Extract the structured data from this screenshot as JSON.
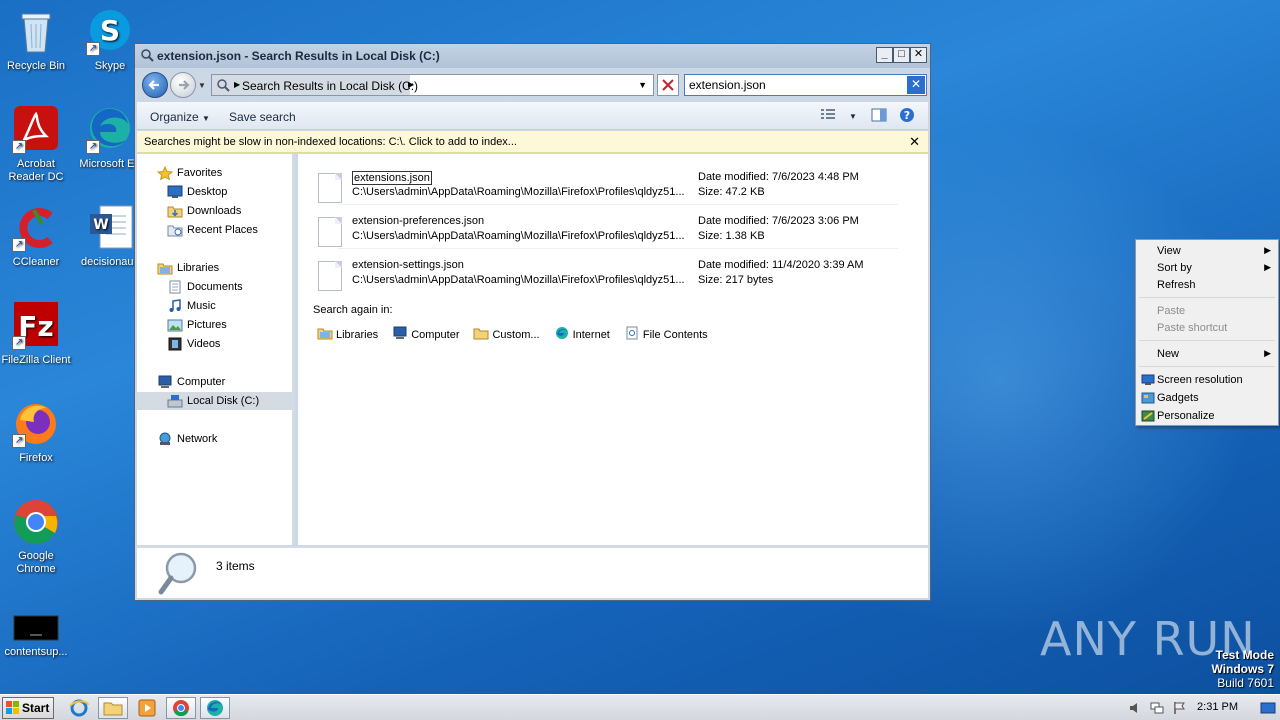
{
  "desktop": {
    "icons": [
      {
        "label": "Recycle Bin",
        "icon": "recycle-bin-icon"
      },
      {
        "label": "Skype",
        "icon": "skype-icon"
      },
      {
        "label": "Acrobat Reader DC",
        "icon": "acrobat-icon"
      },
      {
        "label": "Microsoft Ed",
        "icon": "edge-icon"
      },
      {
        "label": "CCleaner",
        "icon": "ccleaner-icon"
      },
      {
        "label": "decisionaus",
        "icon": "word-doc-icon"
      },
      {
        "label": "FileZilla Client",
        "icon": "filezilla-icon"
      },
      {
        "label": "Firefox",
        "icon": "firefox-icon"
      },
      {
        "label": "Google Chrome",
        "icon": "chrome-icon"
      },
      {
        "label": "contentsup...",
        "icon": "black-file-icon"
      }
    ],
    "watermark": "ANY RUN",
    "test_mode": {
      "line1": "Test Mode",
      "line2": "Windows 7",
      "line3": "Build 7601"
    }
  },
  "window": {
    "title": "extension.json - Search Results in Local Disk (C:)",
    "address_crumb": "Search Results in Local Disk (C:)",
    "search_value": "extension.json",
    "toolbar": {
      "organize": "Organize",
      "save_search": "Save search"
    },
    "infobar": "Searches might be slow in non-indexed locations: C:\\. Click to add to index...",
    "nav": {
      "favorites": "Favorites",
      "desktop": "Desktop",
      "downloads": "Downloads",
      "recent_places": "Recent Places",
      "libraries": "Libraries",
      "documents": "Documents",
      "music": "Music",
      "pictures": "Pictures",
      "videos": "Videos",
      "computer": "Computer",
      "local_disk": "Local Disk (C:)",
      "network": "Network"
    },
    "results": [
      {
        "name": "extensions.json",
        "path": "C:\\Users\\admin\\AppData\\Roaming\\Mozilla\\Firefox\\Profiles\\qldyz51...",
        "date": "Date modified: 7/6/2023 4:48 PM",
        "size": "Size: 47.2 KB"
      },
      {
        "name": "extension-preferences.json",
        "path": "C:\\Users\\admin\\AppData\\Roaming\\Mozilla\\Firefox\\Profiles\\qldyz51...",
        "date": "Date modified: 7/6/2023 3:06 PM",
        "size": "Size: 1.38 KB"
      },
      {
        "name": "extension-settings.json",
        "path": "C:\\Users\\admin\\AppData\\Roaming\\Mozilla\\Firefox\\Profiles\\qldyz51...",
        "date": "Date modified: 11/4/2020 3:39 AM",
        "size": "Size: 217 bytes"
      }
    ],
    "search_again_label": "Search again in:",
    "search_again": {
      "libraries": "Libraries",
      "computer": "Computer",
      "custom": "Custom...",
      "internet": "Internet",
      "file_contents": "File Contents"
    },
    "status_count": "3 items"
  },
  "context_menu": {
    "view": "View",
    "sort_by": "Sort by",
    "refresh": "Refresh",
    "paste": "Paste",
    "paste_shortcut": "Paste shortcut",
    "new": "New",
    "screen_resolution": "Screen resolution",
    "gadgets": "Gadgets",
    "personalize": "Personalize"
  },
  "taskbar": {
    "start": "Start",
    "clock": "2:31 PM"
  }
}
